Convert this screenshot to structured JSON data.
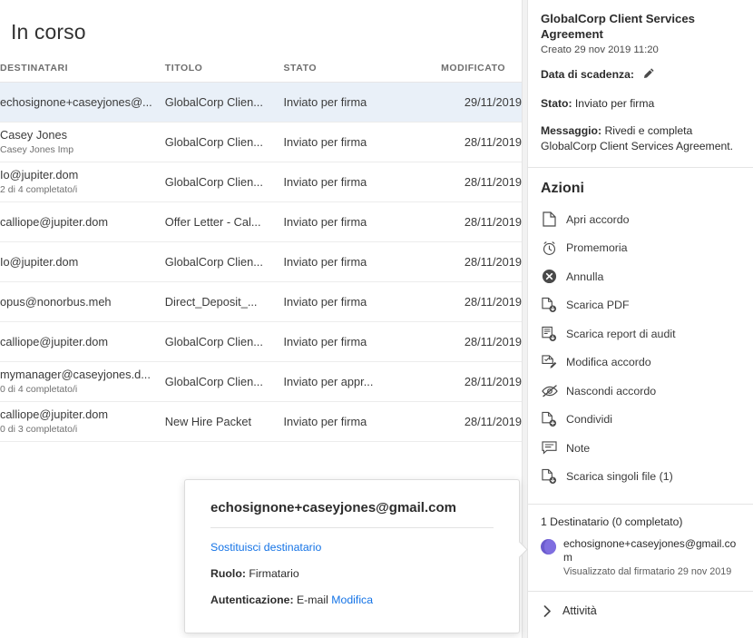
{
  "list": {
    "title": "In corso",
    "columns": {
      "recipients": "DESTINATARI",
      "title": "TITOLO",
      "status": "STATO",
      "modified": "MODIFICATO"
    },
    "rows": [
      {
        "recipient": "echosignone+caseyjones@...",
        "recipient_sub": "",
        "title": "GlobalCorp Clien...",
        "status": "Inviato per firma",
        "modified": "29/11/2019",
        "selected": true
      },
      {
        "recipient": "Casey Jones",
        "recipient_sub": "Casey Jones Imp",
        "title": "GlobalCorp Clien...",
        "status": "Inviato per firma",
        "modified": "28/11/2019",
        "selected": false
      },
      {
        "recipient": "Io@jupiter.dom",
        "recipient_sub": "2 di 4 completato/i",
        "title": "GlobalCorp Clien...",
        "status": "Inviato per firma",
        "modified": "28/11/2019",
        "selected": false
      },
      {
        "recipient": "calliope@jupiter.dom",
        "recipient_sub": "",
        "title": "Offer Letter - Cal...",
        "status": "Inviato per firma",
        "modified": "28/11/2019",
        "selected": false
      },
      {
        "recipient": "Io@jupiter.dom",
        "recipient_sub": "",
        "title": "GlobalCorp Clien...",
        "status": "Inviato per firma",
        "modified": "28/11/2019",
        "selected": false
      },
      {
        "recipient": "opus@nonorbus.meh",
        "recipient_sub": "",
        "title": "Direct_Deposit_...",
        "status": "Inviato per firma",
        "modified": "28/11/2019",
        "selected": false
      },
      {
        "recipient": "calliope@jupiter.dom",
        "recipient_sub": "",
        "title": "GlobalCorp Clien...",
        "status": "Inviato per firma",
        "modified": "28/11/2019",
        "selected": false
      },
      {
        "recipient": "mymanager@caseyjones.d...",
        "recipient_sub": "0 di 4 completato/i",
        "title": "GlobalCorp Clien...",
        "status": "Inviato per appr...",
        "modified": "28/11/2019",
        "selected": false
      },
      {
        "recipient": "calliope@jupiter.dom",
        "recipient_sub": "0 di 3 completato/i",
        "title": "New Hire Packet",
        "status": "Inviato per firma",
        "modified": "28/11/2019",
        "selected": false
      }
    ]
  },
  "detail": {
    "agreement_name": "GlobalCorp Client Services Agreement",
    "created": "Creato 29 nov 2019 11:20",
    "expiry_label": "Data di scadenza:",
    "expiry_icon": "pencil-icon",
    "status_label": "Stato:",
    "status_value": "Inviato per firma",
    "message_label": "Messaggio:",
    "message_value": "Rivedi e completa GlobalCorp Client Services Agreement.",
    "actions_heading": "Azioni",
    "actions": [
      {
        "label": "Apri accordo",
        "icon": "document-icon",
        "key": "apri-accordo"
      },
      {
        "label": "Promemoria",
        "icon": "alarm-clock-icon",
        "key": "promemoria"
      },
      {
        "label": "Annulla",
        "icon": "cancel-circle-icon",
        "key": "annulla"
      },
      {
        "label": "Scarica PDF",
        "icon": "download-pdf-icon",
        "key": "scarica-pdf"
      },
      {
        "label": "Scarica report di audit",
        "icon": "download-report-icon",
        "key": "scarica-report-audit"
      },
      {
        "label": "Modifica accordo",
        "icon": "edit-document-icon",
        "key": "modifica-accordo"
      },
      {
        "label": "Nascondi accordo",
        "icon": "eye-off-icon",
        "key": "nascondi-accordo"
      },
      {
        "label": "Condividi",
        "icon": "share-document-icon",
        "key": "condividi"
      },
      {
        "label": "Note",
        "icon": "note-bubble-icon",
        "key": "note"
      },
      {
        "label": "Scarica singoli file (1)",
        "icon": "download-file-icon",
        "key": "scarica-singoli-file"
      }
    ],
    "recipients_count": "1 Destinatario (0 completato)",
    "recipient": {
      "email": "echosignone+caseyjones@gmail.com",
      "status": "Visualizzato dal firmatario 29 nov 2019"
    },
    "activity_label": "Attività",
    "activity_icon": "chevron-right-icon"
  },
  "popover": {
    "title": "echosignone+caseyjones@gmail.com",
    "replace_link": "Sostituisci destinatario",
    "role_label": "Ruolo:",
    "role_value": "Firmatario",
    "auth_label": "Autenticazione:",
    "auth_value": "E-mail",
    "auth_edit_link": "Modifica"
  },
  "colors": {
    "accent_link": "#1473e6",
    "selected_row": "#e9f0f8",
    "avatar": "#6a5acd",
    "panel_divider": "#e4e4e4"
  }
}
